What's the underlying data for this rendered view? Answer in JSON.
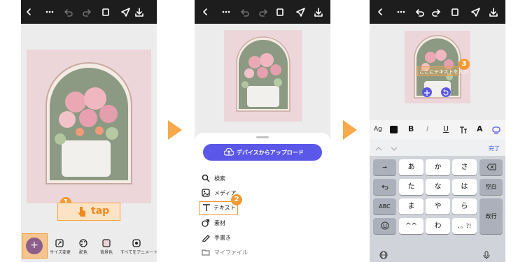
{
  "colors": {
    "accent": "#f7a94b",
    "primary": "#5b57e8",
    "card": "#ecd6d9",
    "dark": "#1d1d1d"
  },
  "icons": [
    "chevron-left-icon",
    "more-icon",
    "undo-icon",
    "redo-icon",
    "layers-icon",
    "send-icon",
    "download-icon"
  ],
  "step1": {
    "badge": "1",
    "tap": "tap",
    "toolbar": [
      {
        "label": "",
        "icon": "plus-icon"
      },
      {
        "label": "サイズ変更",
        "icon": "resize-icon"
      },
      {
        "label": "配色",
        "icon": "palette-icon"
      },
      {
        "label": "背景色",
        "icon": "background-icon"
      },
      {
        "label": "すべてをアニメート",
        "icon": "animate-icon"
      }
    ]
  },
  "step2": {
    "upload_label": "デバイスからアップロード",
    "badge": "2",
    "menu": [
      {
        "label": "検索",
        "icon": "search-icon"
      },
      {
        "label": "メディア",
        "icon": "media-icon"
      },
      {
        "label": "テキスト",
        "icon": "text-icon"
      },
      {
        "label": "素材",
        "icon": "shapes-icon"
      },
      {
        "label": "手書き",
        "icon": "pen-icon"
      },
      {
        "label": "マイファイル",
        "icon": "folder-icon"
      }
    ]
  },
  "step3": {
    "badge": "3",
    "textbox": "ここにテキストを入力",
    "done": "完了",
    "format_ag": "Ag",
    "format_a": "A",
    "keys": {
      "row1": [
        "あ",
        "か",
        "さ"
      ],
      "row2": [
        "た",
        "な",
        "は"
      ],
      "row3": [
        "ま",
        "や",
        "ら"
      ],
      "row4": [
        "^^",
        "わ",
        "、。?!"
      ],
      "left": [
        "→",
        "",
        "ABC",
        ""
      ],
      "right": [
        "",
        "空白",
        "改行"
      ]
    }
  }
}
